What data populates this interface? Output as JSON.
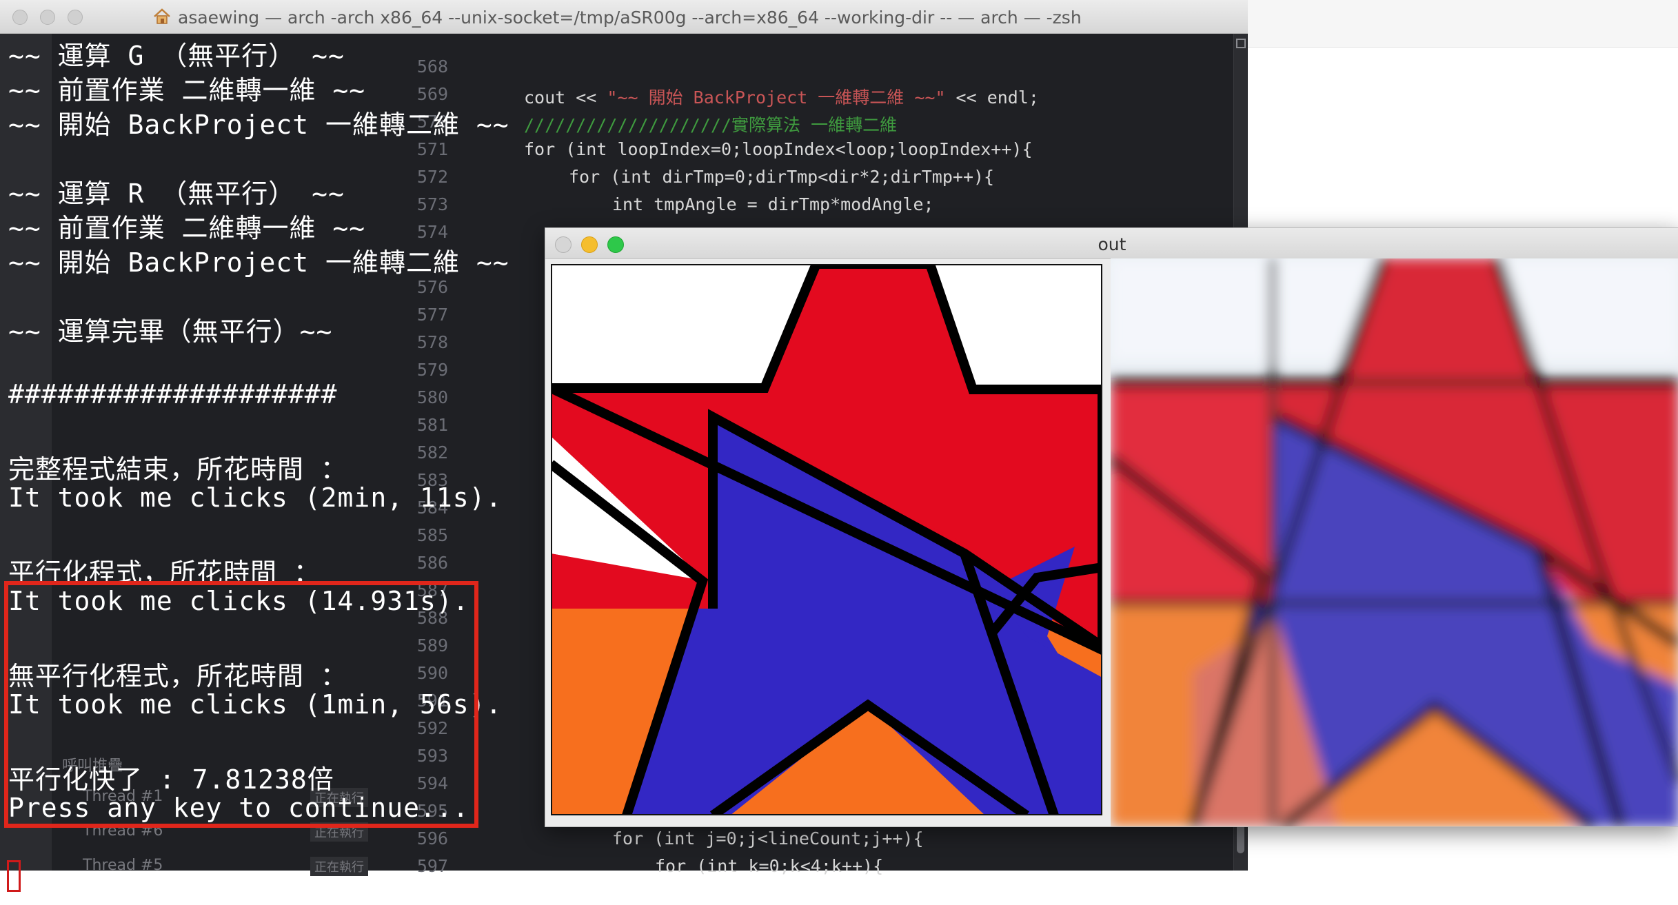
{
  "terminal": {
    "title": "asaewing — arch -arch x86_64  --unix-socket=/tmp/aSR00g --arch=x86_64 --working-dir   -- — arch — -zsh",
    "lines": [
      "~~ 運算 G （無平行） ~~",
      "~~ 前置作業 二維轉一維 ~~",
      "~~ 開始 BackProject 一維轉二維 ~~",
      "~~ 運算 R （無平行） ~~",
      "~~ 前置作業 二維轉一維 ~~",
      "~~ 開始 BackProject 一維轉二維 ~~",
      "~~ 運算完畢（無平行）~~",
      "####################",
      "完整程式結束，所花時間 ：",
      "It took me clicks (2min, 11s).",
      "平行化程式，所花時間 ：",
      "It took me clicks (14.931s).",
      "無平行化程式，所花時間 ：",
      "It took me clicks (1min, 56s).",
      "平行化快了 : 7.81238倍",
      "Press any key to continue..."
    ]
  },
  "editor": {
    "line_numbers": [
      "568",
      "569",
      "570",
      "571",
      "572",
      "573",
      "574",
      "575",
      "576",
      "577",
      "578",
      "579",
      "580",
      "581",
      "582",
      "583",
      "584",
      "585",
      "586",
      "587",
      "588",
      "589",
      "590",
      "591",
      "592",
      "593",
      "594",
      "595",
      "596",
      "597"
    ],
    "code_lines": {
      "l569_a": "cout << ",
      "l569_str": "\"~~ 開始 BackProject 一維轉二維 ~~\"",
      "l569_b": " << endl;",
      "l570_cmt": "////////////////////實際算法 一維轉二維",
      "l571": "for (int loopIndex=0;loopIndex<loop;loopIndex++){",
      "l572": "for (int dirTmp=0;dirTmp<dir*2;dirTmp++){",
      "l573": "int tmpAngle = dirTmp*modAngle;",
      "l596": "for (int j=0;j<lineCount;j++){",
      "l597": "for (int k=0;k<4;k++){"
    },
    "threads": [
      {
        "label": "呼叫堆疊",
        "status": ""
      },
      {
        "label": "Thread #1",
        "status": "正在執行"
      },
      {
        "label": "Thread #6",
        "status": "正在執行"
      },
      {
        "label": "Thread #5",
        "status": "正在執行"
      }
    ]
  },
  "out_window": {
    "title": "out"
  },
  "colors": {
    "terminal_bg": "#1f2024",
    "highlight": "#e0261b",
    "star_red": "#e30a1f",
    "star_blue": "#3327c4",
    "orange": "#f76f1e"
  }
}
